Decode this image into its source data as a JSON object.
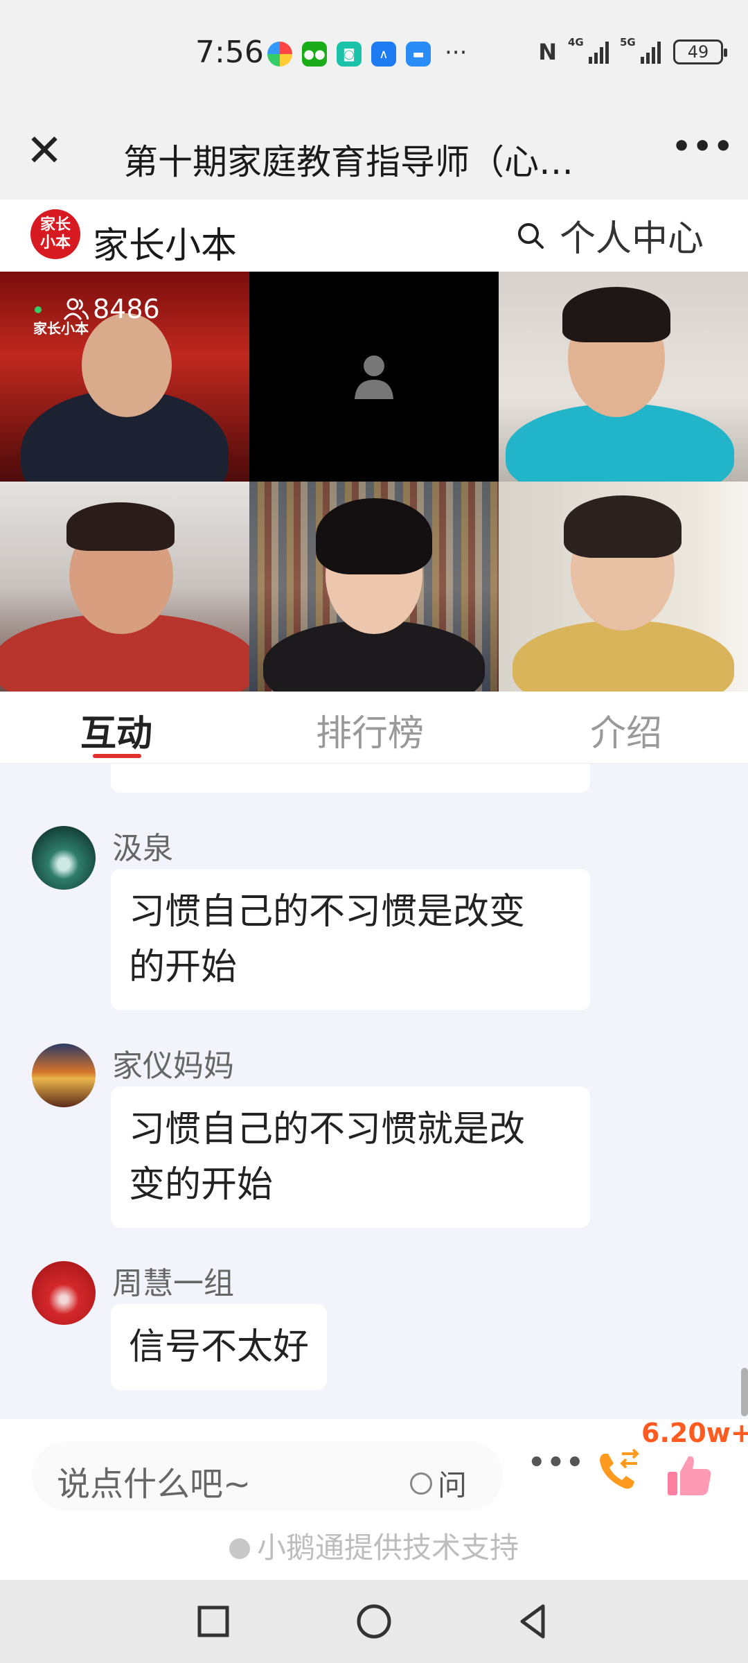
{
  "status_bar": {
    "time": "7:56",
    "more": "···",
    "network_1": "4G",
    "network_2": "5G",
    "battery": "49"
  },
  "title_bar": {
    "title": "第十期家庭教育指导师（心…"
  },
  "site_header": {
    "logo_text": "家长小本",
    "name": "家长小本",
    "user_center": "个人中心"
  },
  "video": {
    "viewers": "8486",
    "brand": "家长小本"
  },
  "tabs": [
    {
      "label": "互动",
      "active": true
    },
    {
      "label": "排行榜",
      "active": false
    },
    {
      "label": "介绍",
      "active": false
    }
  ],
  "messages": [
    {
      "name": "汲泉",
      "lines": [
        "习惯自己的不习惯是改变",
        "的开始"
      ]
    },
    {
      "name": "家仪妈妈",
      "lines": [
        "习惯自己的不习惯就是改",
        "变的开始"
      ]
    },
    {
      "name": "周慧一组",
      "lines": [
        "信号不太好"
      ]
    }
  ],
  "input_bar": {
    "placeholder": "说点什么吧~",
    "ask_label": "问",
    "like_count": "6.20w+",
    "support_text": "小鹅通提供技术支持"
  },
  "colors": {
    "accent": "#e0312c",
    "brand_red": "#d71a21",
    "like_orange": "#ff5a1f",
    "chat_bg": "#f3f4fb"
  }
}
